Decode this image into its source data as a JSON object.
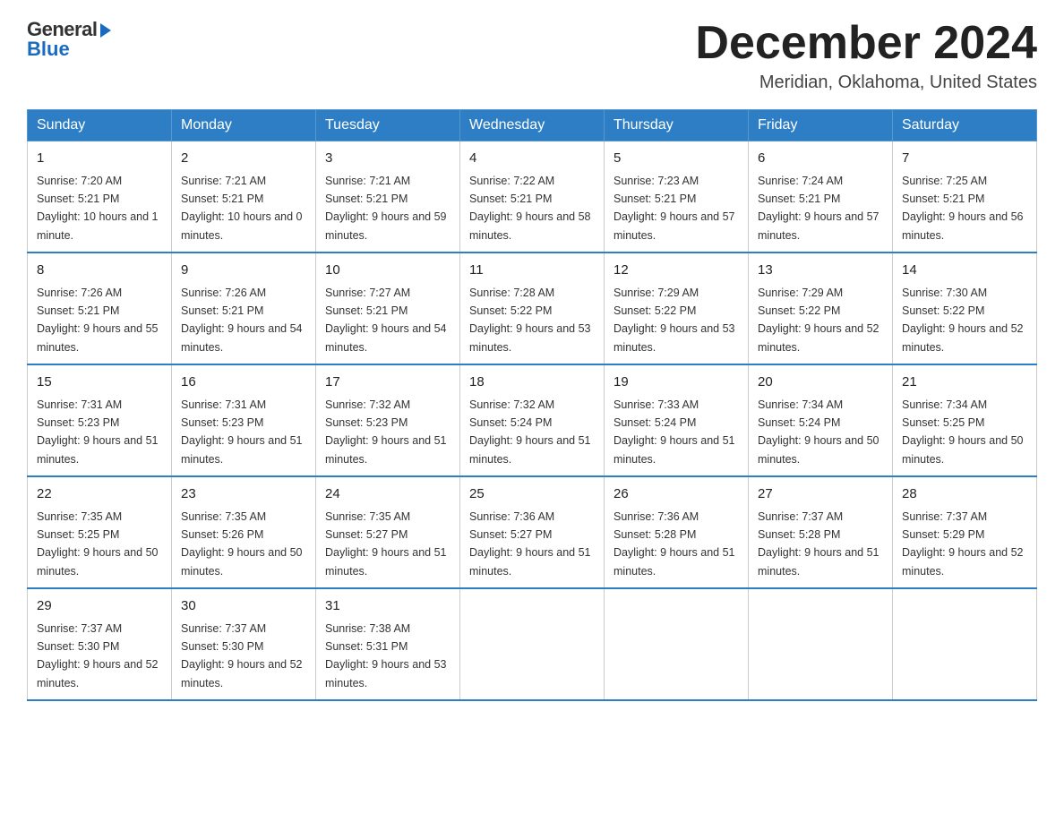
{
  "header": {
    "logo_general": "General",
    "logo_blue": "Blue",
    "month_title": "December 2024",
    "location": "Meridian, Oklahoma, United States"
  },
  "weekdays": [
    "Sunday",
    "Monday",
    "Tuesday",
    "Wednesday",
    "Thursday",
    "Friday",
    "Saturday"
  ],
  "weeks": [
    [
      {
        "day": "1",
        "sunrise": "7:20 AM",
        "sunset": "5:21 PM",
        "daylight": "10 hours and 1 minute."
      },
      {
        "day": "2",
        "sunrise": "7:21 AM",
        "sunset": "5:21 PM",
        "daylight": "10 hours and 0 minutes."
      },
      {
        "day": "3",
        "sunrise": "7:21 AM",
        "sunset": "5:21 PM",
        "daylight": "9 hours and 59 minutes."
      },
      {
        "day": "4",
        "sunrise": "7:22 AM",
        "sunset": "5:21 PM",
        "daylight": "9 hours and 58 minutes."
      },
      {
        "day": "5",
        "sunrise": "7:23 AM",
        "sunset": "5:21 PM",
        "daylight": "9 hours and 57 minutes."
      },
      {
        "day": "6",
        "sunrise": "7:24 AM",
        "sunset": "5:21 PM",
        "daylight": "9 hours and 57 minutes."
      },
      {
        "day": "7",
        "sunrise": "7:25 AM",
        "sunset": "5:21 PM",
        "daylight": "9 hours and 56 minutes."
      }
    ],
    [
      {
        "day": "8",
        "sunrise": "7:26 AM",
        "sunset": "5:21 PM",
        "daylight": "9 hours and 55 minutes."
      },
      {
        "day": "9",
        "sunrise": "7:26 AM",
        "sunset": "5:21 PM",
        "daylight": "9 hours and 54 minutes."
      },
      {
        "day": "10",
        "sunrise": "7:27 AM",
        "sunset": "5:21 PM",
        "daylight": "9 hours and 54 minutes."
      },
      {
        "day": "11",
        "sunrise": "7:28 AM",
        "sunset": "5:22 PM",
        "daylight": "9 hours and 53 minutes."
      },
      {
        "day": "12",
        "sunrise": "7:29 AM",
        "sunset": "5:22 PM",
        "daylight": "9 hours and 53 minutes."
      },
      {
        "day": "13",
        "sunrise": "7:29 AM",
        "sunset": "5:22 PM",
        "daylight": "9 hours and 52 minutes."
      },
      {
        "day": "14",
        "sunrise": "7:30 AM",
        "sunset": "5:22 PM",
        "daylight": "9 hours and 52 minutes."
      }
    ],
    [
      {
        "day": "15",
        "sunrise": "7:31 AM",
        "sunset": "5:23 PM",
        "daylight": "9 hours and 51 minutes."
      },
      {
        "day": "16",
        "sunrise": "7:31 AM",
        "sunset": "5:23 PM",
        "daylight": "9 hours and 51 minutes."
      },
      {
        "day": "17",
        "sunrise": "7:32 AM",
        "sunset": "5:23 PM",
        "daylight": "9 hours and 51 minutes."
      },
      {
        "day": "18",
        "sunrise": "7:32 AM",
        "sunset": "5:24 PM",
        "daylight": "9 hours and 51 minutes."
      },
      {
        "day": "19",
        "sunrise": "7:33 AM",
        "sunset": "5:24 PM",
        "daylight": "9 hours and 51 minutes."
      },
      {
        "day": "20",
        "sunrise": "7:34 AM",
        "sunset": "5:24 PM",
        "daylight": "9 hours and 50 minutes."
      },
      {
        "day": "21",
        "sunrise": "7:34 AM",
        "sunset": "5:25 PM",
        "daylight": "9 hours and 50 minutes."
      }
    ],
    [
      {
        "day": "22",
        "sunrise": "7:35 AM",
        "sunset": "5:25 PM",
        "daylight": "9 hours and 50 minutes."
      },
      {
        "day": "23",
        "sunrise": "7:35 AM",
        "sunset": "5:26 PM",
        "daylight": "9 hours and 50 minutes."
      },
      {
        "day": "24",
        "sunrise": "7:35 AM",
        "sunset": "5:27 PM",
        "daylight": "9 hours and 51 minutes."
      },
      {
        "day": "25",
        "sunrise": "7:36 AM",
        "sunset": "5:27 PM",
        "daylight": "9 hours and 51 minutes."
      },
      {
        "day": "26",
        "sunrise": "7:36 AM",
        "sunset": "5:28 PM",
        "daylight": "9 hours and 51 minutes."
      },
      {
        "day": "27",
        "sunrise": "7:37 AM",
        "sunset": "5:28 PM",
        "daylight": "9 hours and 51 minutes."
      },
      {
        "day": "28",
        "sunrise": "7:37 AM",
        "sunset": "5:29 PM",
        "daylight": "9 hours and 52 minutes."
      }
    ],
    [
      {
        "day": "29",
        "sunrise": "7:37 AM",
        "sunset": "5:30 PM",
        "daylight": "9 hours and 52 minutes."
      },
      {
        "day": "30",
        "sunrise": "7:37 AM",
        "sunset": "5:30 PM",
        "daylight": "9 hours and 52 minutes."
      },
      {
        "day": "31",
        "sunrise": "7:38 AM",
        "sunset": "5:31 PM",
        "daylight": "9 hours and 53 minutes."
      },
      null,
      null,
      null,
      null
    ]
  ]
}
